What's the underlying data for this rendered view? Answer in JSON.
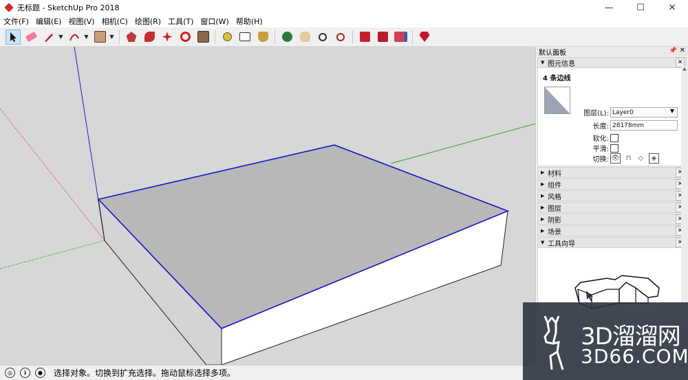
{
  "window": {
    "title": "无标题 - SketchUp Pro 2018",
    "controls": [
      "—",
      "☐",
      "✕"
    ]
  },
  "menu": [
    "文件(F)",
    "编辑(E)",
    "视图(V)",
    "相机(C)",
    "绘图(R)",
    "工具(T)",
    "窗口(W)",
    "帮助(H)"
  ],
  "toolbar": {
    "tools": [
      "select",
      "eraser",
      "pencil",
      "arc",
      "shape",
      "push-pull",
      "follow-me",
      "move",
      "rotate",
      "scale",
      "tape-measure",
      "text",
      "paint-bucket",
      "orbit",
      "pan",
      "zoom",
      "zoom-extents",
      "3d-warehouse",
      "extension-warehouse",
      "send-to-layout",
      "ruby"
    ],
    "active": "select"
  },
  "panel": {
    "title": "默认面板",
    "entity_info": {
      "tray_label": "图元信息",
      "heading": "4 条边线",
      "layer_label": "图层(L):",
      "layer_value": "Layer0",
      "length_label": "长度:",
      "length_value": "28178mm",
      "soften_label": "软化:",
      "smooth_label": "平滑:",
      "toggle_label": "切换:"
    },
    "trays": [
      "材料",
      "组件",
      "风格",
      "图层",
      "阴影",
      "场景"
    ],
    "instructor": {
      "tray_label": "工具向导"
    }
  },
  "status": {
    "message": "选择对象。切换到扩充选择。拖动鼠标选择多项。"
  },
  "watermark": {
    "line1": "3D溜溜网",
    "line2": "3D66.COM"
  },
  "colors": {
    "selection_edge": "#1414c8",
    "top_face": "#b8b8b8",
    "viewport_bg": "#d7d7d7",
    "axis_red": "#c00000",
    "axis_green": "#2ea02e",
    "axis_blue": "#2020c0"
  }
}
